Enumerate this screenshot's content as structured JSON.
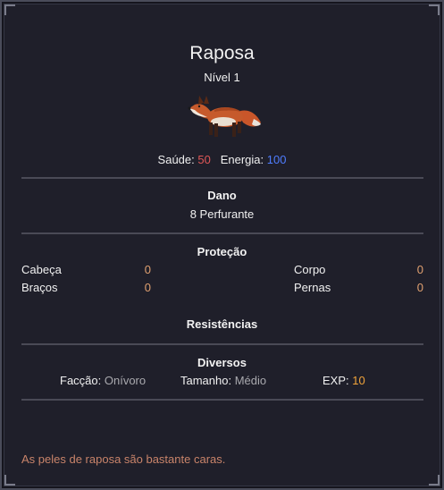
{
  "creature": {
    "name": "Raposa",
    "level": "Nível 1",
    "sprite_icon": "fox-sprite-icon"
  },
  "stats": {
    "health_label": "Saúde:",
    "health_value": "50",
    "energy_label": "Energia:",
    "energy_value": "100"
  },
  "damage": {
    "heading": "Dano",
    "value": "8 Perfurante"
  },
  "protection": {
    "heading": "Proteção",
    "head_label": "Cabeça",
    "head_value": "0",
    "body_label": "Corpo",
    "body_value": "0",
    "arms_label": "Braços",
    "arms_value": "0",
    "legs_label": "Pernas",
    "legs_value": "0"
  },
  "resistances": {
    "heading": "Resistências"
  },
  "misc": {
    "heading": "Diversos",
    "faction_label": "Facção:",
    "faction_value": "Onívoro",
    "size_label": "Tamanho:",
    "size_value": "Médio",
    "exp_label": "EXP:",
    "exp_value": "10"
  },
  "description": "As peles de raposa são bastante caras.",
  "colors": {
    "background": "#1f1f2a",
    "health": "#e05757",
    "energy": "#4f7dff",
    "exp": "#f0a33a",
    "description": "#c9846a",
    "divider": "#4a4a56"
  }
}
